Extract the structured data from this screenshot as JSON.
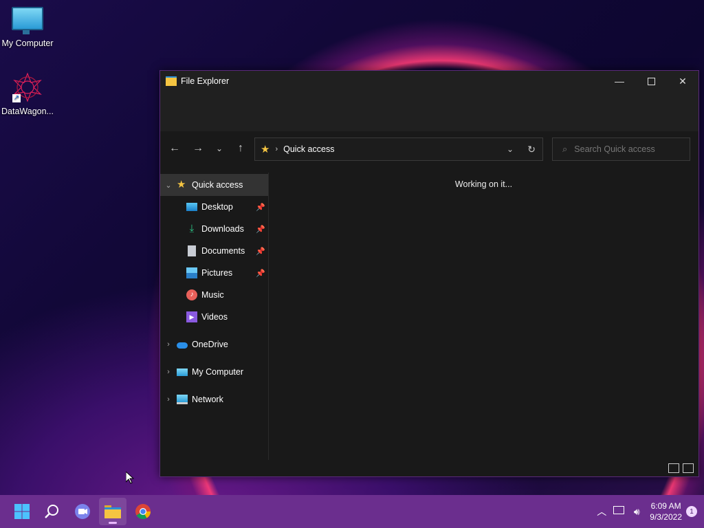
{
  "desktop": {
    "icons": [
      {
        "label": "My Computer"
      },
      {
        "label": "DataWagon..."
      }
    ]
  },
  "window": {
    "title": "File Explorer",
    "address": {
      "breadcrumb": "Quick access"
    },
    "search": {
      "placeholder": "Search Quick access"
    },
    "status_message": "Working on it...",
    "sidebar": {
      "items": [
        {
          "label": "Quick access"
        },
        {
          "label": "Desktop"
        },
        {
          "label": "Downloads"
        },
        {
          "label": "Documents"
        },
        {
          "label": "Pictures"
        },
        {
          "label": "Music"
        },
        {
          "label": "Videos"
        },
        {
          "label": "OneDrive"
        },
        {
          "label": "My Computer"
        },
        {
          "label": "Network"
        }
      ]
    }
  },
  "taskbar": {
    "clock": {
      "time": "6:09 AM",
      "date": "9/3/2022"
    },
    "notification_count": "1"
  },
  "colors": {
    "taskbar": "#6b2e8e",
    "window_bg": "#191919",
    "accent": "#e9b8ff"
  }
}
